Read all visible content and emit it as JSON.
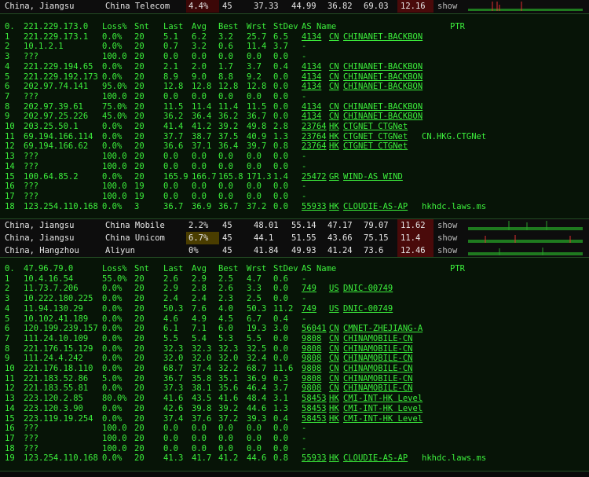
{
  "colors": {
    "trace_text": "#3cf03c",
    "panel_bg": "#071407",
    "loss_warn": "#6b0d0d",
    "loss_mid": "#5a4800",
    "latency_bg": "#4a0a0a",
    "spark": "#2aa02a",
    "spike": "#e03030"
  },
  "summary_rows": [
    {
      "location": "China, Jiangsu",
      "isp": "China Telecom",
      "loss": "4.4%",
      "sent": "45",
      "last": "37.33",
      "avg": "44.99",
      "best": "36.82",
      "worst": "69.03",
      "stdev": "12.16",
      "action": "show"
    },
    {
      "location": "China, Jiangsu",
      "isp": "China Mobile",
      "loss": "2.2%",
      "sent": "45",
      "last": "48.01",
      "avg": "55.14",
      "best": "47.17",
      "worst": "79.07",
      "stdev": "11.62",
      "action": "show"
    },
    {
      "location": "China, Jiangsu",
      "isp": "China Unicom",
      "loss": "6.7%",
      "sent": "45",
      "last": "44.1",
      "avg": "51.55",
      "best": "43.66",
      "worst": "75.15",
      "stdev": "11.4",
      "action": "show"
    },
    {
      "location": "China, Hangzhou",
      "isp": "Aliyun",
      "loss": "0%",
      "sent": "45",
      "last": "41.84",
      "avg": "49.93",
      "best": "41.24",
      "worst": "73.6",
      "stdev": "12.46",
      "action": "show"
    }
  ],
  "trace1": {
    "header": {
      "hop": "0.",
      "host": "221.229.173.0",
      "loss": "Loss%",
      "snt": "Snt",
      "last": "Last",
      "avg": "Avg",
      "best": "Best",
      "wrst": "Wrst",
      "stdev": "StDev",
      "asname": "AS Name",
      "ptr": "PTR"
    },
    "hops": [
      {
        "hop": "1",
        "host": "221.229.173.1",
        "loss": "0.0%",
        "snt": "20",
        "last": "5.1",
        "avg": "6.2",
        "best": "3.2",
        "wrst": "25.7",
        "stdev": "6.5",
        "as": "4134",
        "cc": "CN",
        "name": "CHINANET-BACKBON",
        "ptr": ""
      },
      {
        "hop": "2",
        "host": "10.1.2.1",
        "loss": "0.0%",
        "snt": "20",
        "last": "0.7",
        "avg": "3.2",
        "best": "0.6",
        "wrst": "11.4",
        "stdev": "3.7",
        "as": "-",
        "cc": "",
        "name": "",
        "ptr": ""
      },
      {
        "hop": "3",
        "host": "???",
        "loss": "100.0",
        "snt": "20",
        "last": "0.0",
        "avg": "0.0",
        "best": "0.0",
        "wrst": "0.0",
        "stdev": "0.0",
        "as": "-",
        "cc": "",
        "name": "",
        "ptr": ""
      },
      {
        "hop": "4",
        "host": "221.229.194.65",
        "loss": "0.0%",
        "snt": "20",
        "last": "2.1",
        "avg": "2.0",
        "best": "1.7",
        "wrst": "3.7",
        "stdev": "0.4",
        "as": "4134",
        "cc": "CN",
        "name": "CHINANET-BACKBON",
        "ptr": ""
      },
      {
        "hop": "5",
        "host": "221.229.192.173",
        "loss": "0.0%",
        "snt": "20",
        "last": "8.9",
        "avg": "9.0",
        "best": "8.8",
        "wrst": "9.2",
        "stdev": "0.0",
        "as": "4134",
        "cc": "CN",
        "name": "CHINANET-BACKBON",
        "ptr": ""
      },
      {
        "hop": "6",
        "host": "202.97.74.141",
        "loss": "95.0%",
        "snt": "20",
        "last": "12.8",
        "avg": "12.8",
        "best": "12.8",
        "wrst": "12.8",
        "stdev": "0.0",
        "as": "4134",
        "cc": "CN",
        "name": "CHINANET-BACKBON",
        "ptr": ""
      },
      {
        "hop": "7",
        "host": "???",
        "loss": "100.0",
        "snt": "20",
        "last": "0.0",
        "avg": "0.0",
        "best": "0.0",
        "wrst": "0.0",
        "stdev": "0.0",
        "as": "-",
        "cc": "",
        "name": "",
        "ptr": ""
      },
      {
        "hop": "8",
        "host": "202.97.39.61",
        "loss": "75.0%",
        "snt": "20",
        "last": "11.5",
        "avg": "11.4",
        "best": "11.4",
        "wrst": "11.5",
        "stdev": "0.0",
        "as": "4134",
        "cc": "CN",
        "name": "CHINANET-BACKBON",
        "ptr": ""
      },
      {
        "hop": "9",
        "host": "202.97.25.226",
        "loss": "45.0%",
        "snt": "20",
        "last": "36.2",
        "avg": "36.4",
        "best": "36.2",
        "wrst": "36.7",
        "stdev": "0.0",
        "as": "4134",
        "cc": "CN",
        "name": "CHINANET-BACKBON",
        "ptr": ""
      },
      {
        "hop": "10",
        "host": "203.25.50.1",
        "loss": "0.0%",
        "snt": "20",
        "last": "41.4",
        "avg": "41.2",
        "best": "39.2",
        "wrst": "49.8",
        "stdev": "2.8",
        "as": "23764",
        "cc": "HK",
        "name": "CTGNET CTGNet",
        "ptr": ""
      },
      {
        "hop": "11",
        "host": "69.194.166.114",
        "loss": "0.0%",
        "snt": "20",
        "last": "37.7",
        "avg": "38.7",
        "best": "37.5",
        "wrst": "40.9",
        "stdev": "1.3",
        "as": "23764",
        "cc": "HK",
        "name": "CTGNET CTGNet",
        "ptr": "CN.HKG.CTGNet"
      },
      {
        "hop": "12",
        "host": "69.194.166.62",
        "loss": "0.0%",
        "snt": "20",
        "last": "36.6",
        "avg": "37.1",
        "best": "36.4",
        "wrst": "39.7",
        "stdev": "0.8",
        "as": "23764",
        "cc": "HK",
        "name": "CTGNET CTGNet",
        "ptr": ""
      },
      {
        "hop": "13",
        "host": "???",
        "loss": "100.0",
        "snt": "20",
        "last": "0.0",
        "avg": "0.0",
        "best": "0.0",
        "wrst": "0.0",
        "stdev": "0.0",
        "as": "-",
        "cc": "",
        "name": "",
        "ptr": ""
      },
      {
        "hop": "14",
        "host": "???",
        "loss": "100.0",
        "snt": "20",
        "last": "0.0",
        "avg": "0.0",
        "best": "0.0",
        "wrst": "0.0",
        "stdev": "0.0",
        "as": "-",
        "cc": "",
        "name": "",
        "ptr": ""
      },
      {
        "hop": "15",
        "host": "100.64.85.2",
        "loss": "0.0%",
        "snt": "20",
        "last": "165.9",
        "avg": "166.7",
        "best": "165.8",
        "wrst": "171.3",
        "stdev": "1.4",
        "as": "25472",
        "cc": "GR",
        "name": "WIND-AS WIND",
        "ptr": ""
      },
      {
        "hop": "16",
        "host": "???",
        "loss": "100.0",
        "snt": "19",
        "last": "0.0",
        "avg": "0.0",
        "best": "0.0",
        "wrst": "0.0",
        "stdev": "0.0",
        "as": "-",
        "cc": "",
        "name": "",
        "ptr": ""
      },
      {
        "hop": "17",
        "host": "???",
        "loss": "100.0",
        "snt": "19",
        "last": "0.0",
        "avg": "0.0",
        "best": "0.0",
        "wrst": "0.0",
        "stdev": "0.0",
        "as": "-",
        "cc": "",
        "name": "",
        "ptr": ""
      },
      {
        "hop": "18",
        "host": "123.254.110.168",
        "loss": "0.0%",
        "snt": "3",
        "last": "36.7",
        "avg": "36.9",
        "best": "36.7",
        "wrst": "37.2",
        "stdev": "0.0",
        "as": "55933",
        "cc": "HK",
        "name": "CLOUDIE-AS-AP",
        "ptr": "hkhdc.laws.ms"
      }
    ]
  },
  "trace2": {
    "header": {
      "hop": "0.",
      "host": "47.96.79.0",
      "loss": "Loss%",
      "snt": "Snt",
      "last": "Last",
      "avg": "Avg",
      "best": "Best",
      "wrst": "Wrst",
      "stdev": "StDev",
      "asname": "AS Name",
      "ptr": "PTR"
    },
    "hops": [
      {
        "hop": "1",
        "host": "10.4.16.54",
        "loss": "55.0%",
        "snt": "20",
        "last": "2.6",
        "avg": "2.9",
        "best": "2.5",
        "wrst": "4.7",
        "stdev": "0.6",
        "as": "-",
        "cc": "",
        "name": "",
        "ptr": ""
      },
      {
        "hop": "2",
        "host": "11.73.7.206",
        "loss": "0.0%",
        "snt": "20",
        "last": "2.9",
        "avg": "2.8",
        "best": "2.6",
        "wrst": "3.3",
        "stdev": "0.0",
        "as": "749",
        "cc": "US",
        "name": "DNIC-00749",
        "ptr": ""
      },
      {
        "hop": "3",
        "host": "10.222.180.225",
        "loss": "0.0%",
        "snt": "20",
        "last": "2.4",
        "avg": "2.4",
        "best": "2.3",
        "wrst": "2.5",
        "stdev": "0.0",
        "as": "-",
        "cc": "",
        "name": "",
        "ptr": ""
      },
      {
        "hop": "4",
        "host": "11.94.130.29",
        "loss": "0.0%",
        "snt": "20",
        "last": "50.3",
        "avg": "7.6",
        "best": "4.0",
        "wrst": "50.3",
        "stdev": "11.2",
        "as": "749",
        "cc": "US",
        "name": "DNIC-00749",
        "ptr": ""
      },
      {
        "hop": "5",
        "host": "10.102.41.189",
        "loss": "0.0%",
        "snt": "20",
        "last": "4.6",
        "avg": "4.9",
        "best": "4.5",
        "wrst": "6.7",
        "stdev": "0.4",
        "as": "-",
        "cc": "",
        "name": "",
        "ptr": ""
      },
      {
        "hop": "6",
        "host": "120.199.239.157",
        "loss": "0.0%",
        "snt": "20",
        "last": "6.1",
        "avg": "7.1",
        "best": "6.0",
        "wrst": "19.3",
        "stdev": "3.0",
        "as": "56041",
        "cc": "CN",
        "name": "CMNET-ZHEJIANG-A",
        "ptr": ""
      },
      {
        "hop": "7",
        "host": "111.24.10.109",
        "loss": "0.0%",
        "snt": "20",
        "last": "5.5",
        "avg": "5.4",
        "best": "5.3",
        "wrst": "5.5",
        "stdev": "0.0",
        "as": "9808",
        "cc": "CN",
        "name": "CHINAMOBILE-CN",
        "ptr": ""
      },
      {
        "hop": "8",
        "host": "221.176.15.129",
        "loss": "0.0%",
        "snt": "20",
        "last": "32.3",
        "avg": "32.3",
        "best": "32.3",
        "wrst": "32.5",
        "stdev": "0.0",
        "as": "9808",
        "cc": "CN",
        "name": "CHINAMOBILE-CN",
        "ptr": ""
      },
      {
        "hop": "9",
        "host": "111.24.4.242",
        "loss": "0.0%",
        "snt": "20",
        "last": "32.0",
        "avg": "32.0",
        "best": "32.0",
        "wrst": "32.4",
        "stdev": "0.0",
        "as": "9808",
        "cc": "CN",
        "name": "CHINAMOBILE-CN",
        "ptr": ""
      },
      {
        "hop": "10",
        "host": "221.176.18.110",
        "loss": "0.0%",
        "snt": "20",
        "last": "68.7",
        "avg": "37.4",
        "best": "32.2",
        "wrst": "68.7",
        "stdev": "11.6",
        "as": "9808",
        "cc": "CN",
        "name": "CHINAMOBILE-CN",
        "ptr": ""
      },
      {
        "hop": "11",
        "host": "221.183.52.86",
        "loss": "5.0%",
        "snt": "20",
        "last": "36.7",
        "avg": "35.8",
        "best": "35.1",
        "wrst": "36.9",
        "stdev": "0.3",
        "as": "9808",
        "cc": "CN",
        "name": "CHINAMOBILE-CN",
        "ptr": ""
      },
      {
        "hop": "12",
        "host": "221.183.55.81",
        "loss": "0.0%",
        "snt": "20",
        "last": "37.3",
        "avg": "38.1",
        "best": "35.6",
        "wrst": "46.4",
        "stdev": "3.7",
        "as": "9808",
        "cc": "CN",
        "name": "CHINAMOBILE-CN",
        "ptr": ""
      },
      {
        "hop": "13",
        "host": "223.120.2.85",
        "loss": "80.0%",
        "snt": "20",
        "last": "41.6",
        "avg": "43.5",
        "best": "41.6",
        "wrst": "48.4",
        "stdev": "3.1",
        "as": "58453",
        "cc": "HK",
        "name": "CMI-INT-HK Level",
        "ptr": ""
      },
      {
        "hop": "14",
        "host": "223.120.3.90",
        "loss": "0.0%",
        "snt": "20",
        "last": "42.6",
        "avg": "39.8",
        "best": "39.2",
        "wrst": "44.6",
        "stdev": "1.3",
        "as": "58453",
        "cc": "HK",
        "name": "CMI-INT-HK Level",
        "ptr": ""
      },
      {
        "hop": "15",
        "host": "223.119.19.254",
        "loss": "0.0%",
        "snt": "20",
        "last": "37.4",
        "avg": "37.6",
        "best": "37.2",
        "wrst": "39.3",
        "stdev": "0.4",
        "as": "58453",
        "cc": "HK",
        "name": "CMI-INT-HK Level",
        "ptr": ""
      },
      {
        "hop": "16",
        "host": "???",
        "loss": "100.0",
        "snt": "20",
        "last": "0.0",
        "avg": "0.0",
        "best": "0.0",
        "wrst": "0.0",
        "stdev": "0.0",
        "as": "-",
        "cc": "",
        "name": "",
        "ptr": ""
      },
      {
        "hop": "17",
        "host": "???",
        "loss": "100.0",
        "snt": "20",
        "last": "0.0",
        "avg": "0.0",
        "best": "0.0",
        "wrst": "0.0",
        "stdev": "0.0",
        "as": "-",
        "cc": "",
        "name": "",
        "ptr": ""
      },
      {
        "hop": "18",
        "host": "???",
        "loss": "100.0",
        "snt": "20",
        "last": "0.0",
        "avg": "0.0",
        "best": "0.0",
        "wrst": "0.0",
        "stdev": "0.0",
        "as": "-",
        "cc": "",
        "name": "",
        "ptr": ""
      },
      {
        "hop": "19",
        "host": "123.254.110.168",
        "loss": "0.0%",
        "snt": "20",
        "last": "41.3",
        "avg": "41.7",
        "best": "41.2",
        "wrst": "44.6",
        "stdev": "0.8",
        "as": "55933",
        "cc": "HK",
        "name": "CLOUDIE-AS-AP",
        "ptr": "hkhdc.laws.ms"
      }
    ]
  }
}
